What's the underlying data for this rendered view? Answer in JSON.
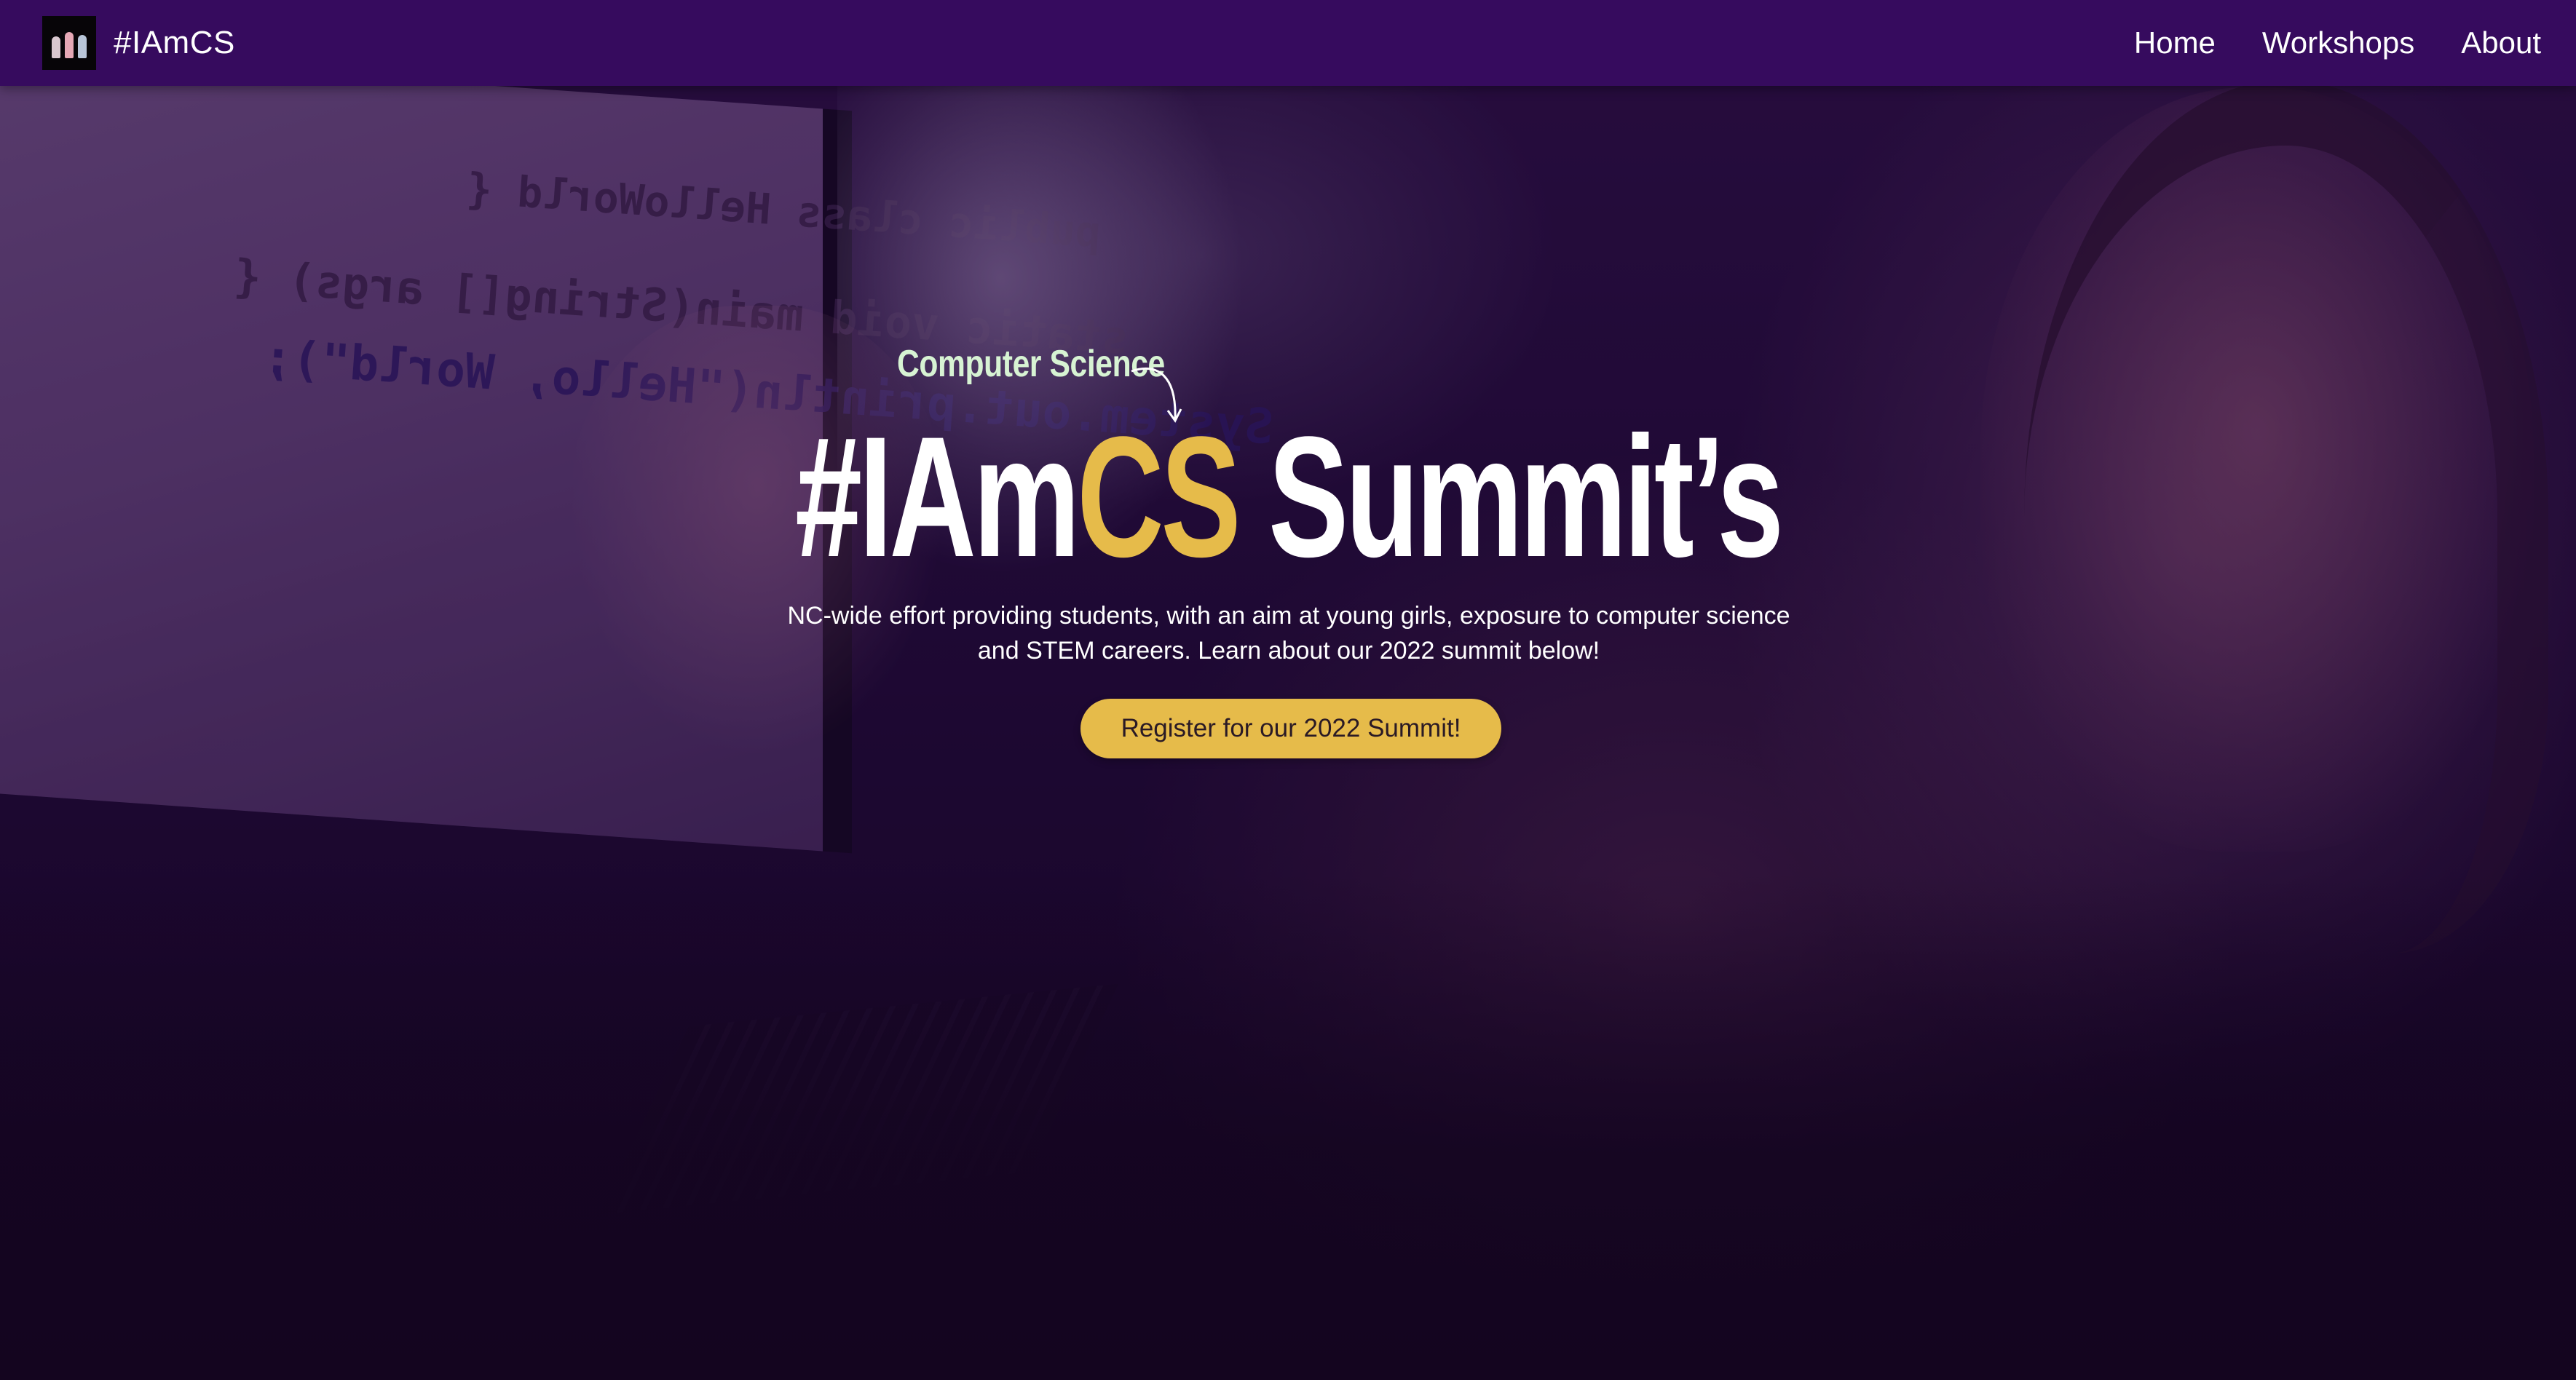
{
  "navbar": {
    "logo_icon": "iamcs-logo",
    "brand": "#IAmCS",
    "links": [
      {
        "label": "Home"
      },
      {
        "label": "Workshops"
      },
      {
        "label": "About"
      }
    ]
  },
  "hero": {
    "background_image": "girl-pointing-at-computer-screen-photo",
    "code_lines": [
      "public class HelloWorld {",
      "static void main(String[] args) {",
      "System.out.println(\"Hello, World\");"
    ],
    "eyebrow": "Computer Science",
    "headline_part1": "#IAm",
    "headline_accent": "CS",
    "headline_part2": " Summit’s",
    "subtext": "NC-wide effort providing students, with an aim at young girls, exposure to computer science and STEM careers. Learn about our 2022 summit below!",
    "cta_label": "Register for our 2022 Summit!"
  },
  "colors": {
    "navbar": "#360b5e",
    "accent": "#e6bb4a",
    "eyebrow": "#d7f3d3",
    "text": "#ffffff"
  }
}
